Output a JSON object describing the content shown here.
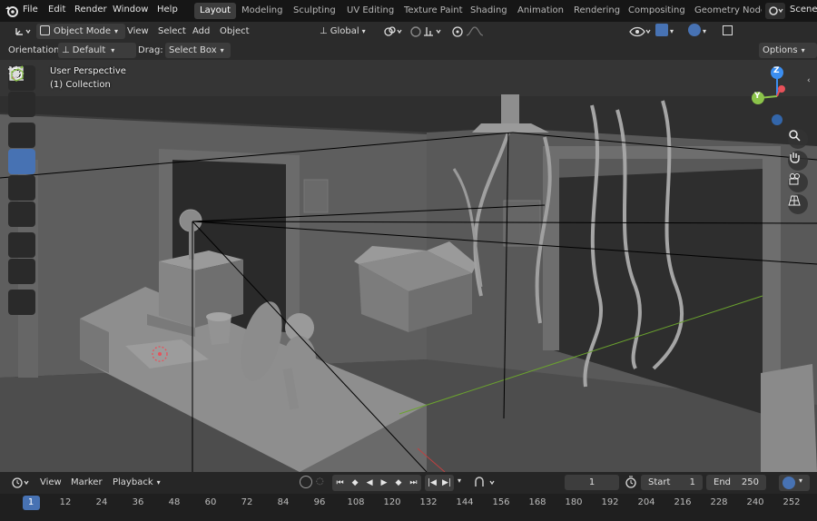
{
  "menubar": {
    "items": [
      "File",
      "Edit",
      "Render",
      "Window",
      "Help"
    ],
    "workspaces": [
      "Layout",
      "Modeling",
      "Sculpting",
      "UV Editing",
      "Texture Paint",
      "Shading",
      "Animation",
      "Rendering",
      "Compositing",
      "Geometry Node"
    ],
    "active_workspace": "Layout",
    "scene_label": "Scene"
  },
  "header": {
    "mode": "Object Mode",
    "menus": [
      "View",
      "Select",
      "Add",
      "Object"
    ],
    "transform_orientation": "Global"
  },
  "tool_settings": {
    "orientation_label": "Orientation:",
    "orientation_value": "Default",
    "drag_label": "Drag:",
    "drag_value": "Select Box",
    "options_label": "Options"
  },
  "viewport": {
    "view_name": "User Perspective",
    "collection": "(1) Collection",
    "gizmo": {
      "z": "Z",
      "y": "Y"
    }
  },
  "timeline": {
    "menus": [
      "View",
      "Marker",
      "Playback"
    ],
    "current_frame": "1",
    "start_label": "Start",
    "start_value": "1",
    "end_label": "End",
    "end_value": "250",
    "ruler_ticks": [
      "1",
      "12",
      "24",
      "36",
      "48",
      "60",
      "72",
      "84",
      "96",
      "108",
      "120",
      "132",
      "144",
      "156",
      "168",
      "180",
      "192",
      "204",
      "216",
      "228",
      "240",
      "252"
    ]
  },
  "colors": {
    "accent": "#4772b3",
    "active_frame": "#4772b3",
    "axis_x": "#e8515a",
    "axis_y": "#8bc34a",
    "axis_z": "#3b8ef0"
  }
}
